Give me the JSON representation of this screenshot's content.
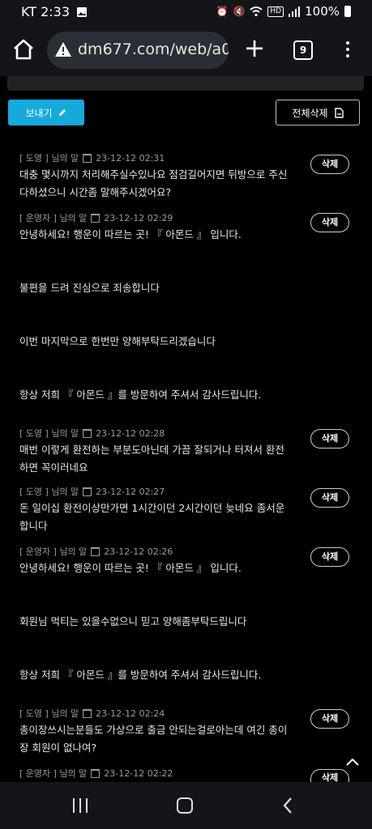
{
  "status": {
    "carrier": "KT 2:33",
    "battery": "100%"
  },
  "browser": {
    "url": "dm677.com/web/a0",
    "tab_count": "9"
  },
  "actions": {
    "send_label": "보내기",
    "delete_all_label": "전체삭제",
    "delete_label": "삭제"
  },
  "messages": [
    {
      "sender": "[ 도영 ] 님의 말",
      "time": "23-12-12 02:31",
      "text": "대충 몇시까지 처리해주실수있나요 점검길어지면 뒤방으로 주신\n다하셨으니 시간좀 말해주시겠어요?"
    },
    {
      "sender": "[ 운영자 ] 님의 말",
      "time": "23-12-12 02:29",
      "text": "안녕하세요! 행운이 따르는 곳! 『 아몬드 』 입니다.\n\n\n불편을 드려 진심으로 죄송합니다\n\n\n이번 마지막으로 한번만 양해부탁드리겠습니다\n\n\n항상 저희 『 아몬드 』를 방문하여 주셔서 감사드립니다."
    },
    {
      "sender": "[ 도영 ] 님의 말",
      "time": "23-12-12 02:28",
      "text": "매번 이렇게 환전하는 부분도아닌데 가끔 잘되거나 터져서 환전\n하면 꼭이러네요"
    },
    {
      "sender": "[ 도영 ] 님의 말",
      "time": "23-12-12 02:27",
      "text": "돈 일이십 환전이상만가면 1시간이던 2시간이던 늦네요 좀서운\n합니다"
    },
    {
      "sender": "[ 운영자 ] 님의 말",
      "time": "23-12-12 02:26",
      "text": "안녕하세요! 행운이 따르는 곳! 『 아몬드 』 입니다.\n\n\n회원님 먹티는 있을수없으니 믿고 양해좀부탁드립니다\n\n\n항상 저희 『 아몬드 』를 방문하여 주셔서 감사드립니다."
    },
    {
      "sender": "[ 도영 ] 님의 말",
      "time": "23-12-12 02:24",
      "text": "총이장쓰시는분들도 가상으로 출금 안되는걸로아는데 여긴 총이\n장 회원이 없나여?"
    },
    {
      "sender": "[ 운영자 ] 님의 말",
      "time": "23-12-12 02:22",
      "text": ""
    }
  ]
}
